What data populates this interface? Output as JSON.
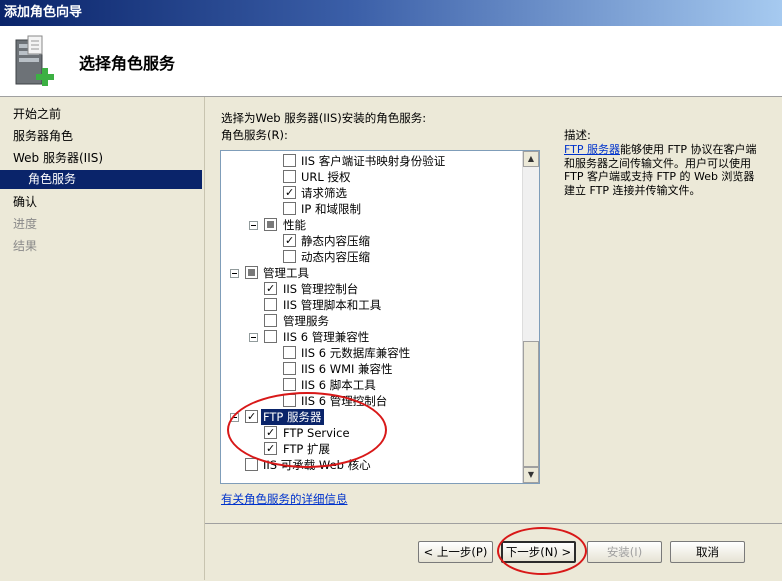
{
  "window": {
    "title": "添加角色向导"
  },
  "header": {
    "title": "选择角色服务"
  },
  "nav": {
    "items": [
      {
        "label": "开始之前",
        "state": "normal"
      },
      {
        "label": "服务器角色",
        "state": "normal"
      },
      {
        "label": "Web 服务器(IIS)",
        "state": "normal"
      },
      {
        "label": "角色服务",
        "state": "active"
      },
      {
        "label": "确认",
        "state": "normal"
      },
      {
        "label": "进度",
        "state": "disabled"
      },
      {
        "label": "结果",
        "state": "disabled"
      }
    ]
  },
  "content": {
    "instruction": "选择为Web 服务器(IIS)安装的角色服务:",
    "list_label": "角色服务(R):",
    "tree": [
      {
        "label": "IIS 客户端证书映射身份验证",
        "state": "unchecked"
      },
      {
        "label": "URL 授权",
        "state": "unchecked"
      },
      {
        "label": "请求筛选",
        "state": "checked"
      },
      {
        "label": "IP 和域限制",
        "state": "unchecked"
      },
      {
        "label": "性能",
        "state": "partial"
      },
      {
        "label": "静态内容压缩",
        "state": "checked"
      },
      {
        "label": "动态内容压缩",
        "state": "unchecked"
      },
      {
        "label": "管理工具",
        "state": "partial"
      },
      {
        "label": "IIS 管理控制台",
        "state": "checked"
      },
      {
        "label": "IIS 管理脚本和工具",
        "state": "unchecked"
      },
      {
        "label": "管理服务",
        "state": "unchecked"
      },
      {
        "label": "IIS 6 管理兼容性",
        "state": "unchecked"
      },
      {
        "label": "IIS 6 元数据库兼容性",
        "state": "unchecked"
      },
      {
        "label": "IIS 6 WMI 兼容性",
        "state": "unchecked"
      },
      {
        "label": "IIS 6 脚本工具",
        "state": "unchecked"
      },
      {
        "label": "IIS 6 管理控制台",
        "state": "unchecked"
      },
      {
        "label": "FTP 服务器",
        "state": "checked",
        "selected": true
      },
      {
        "label": "FTP Service",
        "state": "checked"
      },
      {
        "label": "FTP 扩展",
        "state": "checked"
      },
      {
        "label": "IIS 可承载 Web 核心",
        "state": "unchecked"
      }
    ],
    "more_info_link": "有关角色服务的详细信息"
  },
  "description": {
    "label": "描述:",
    "link": "FTP 服务器",
    "text": "能够使用 FTP 协议在客户端和服务器之间传输文件。用户可以使用 FTP 客户端或支持 FTP 的 Web 浏览器建立 FTP 连接并传输文件。"
  },
  "buttons": {
    "prev": "< 上一步(P)",
    "next": "下一步(N) >",
    "install": "安装(I)",
    "cancel": "取消"
  },
  "colors": {
    "selection": "#0a246a",
    "link": "#0033cc",
    "annotation": "#d81818"
  }
}
